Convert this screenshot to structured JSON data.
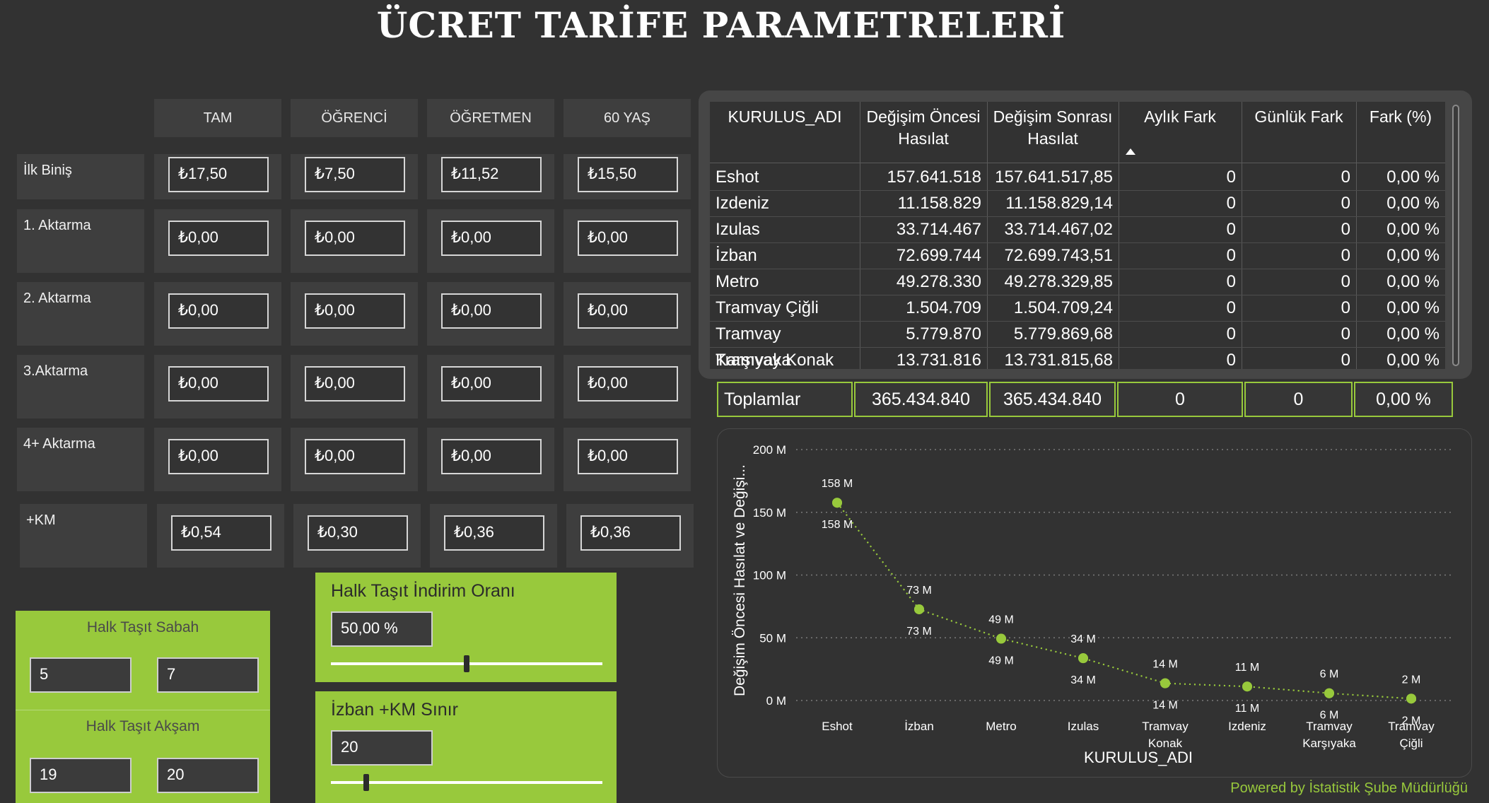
{
  "title": "ÜCRET TARİFE PARAMETRELERİ",
  "fare_table": {
    "columns": [
      "TAM",
      "ÖĞRENCİ",
      "ÖĞRETMEN",
      "60 YAŞ"
    ],
    "rows": [
      {
        "label": "İlk Biniş",
        "values": [
          "₺17,50",
          "₺7,50",
          "₺11,52",
          "₺15,50"
        ]
      },
      {
        "label": "1. Aktarma",
        "values": [
          "₺0,00",
          "₺0,00",
          "₺0,00",
          "₺0,00"
        ]
      },
      {
        "label": "2. Aktarma",
        "values": [
          "₺0,00",
          "₺0,00",
          "₺0,00",
          "₺0,00"
        ]
      },
      {
        "label": "3.Aktarma",
        "values": [
          "₺0,00",
          "₺0,00",
          "₺0,00",
          "₺0,00"
        ]
      },
      {
        "label": "4+ Aktarma",
        "values": [
          "₺0,00",
          "₺0,00",
          "₺0,00",
          "₺0,00"
        ]
      },
      {
        "label": "+KM",
        "values": [
          "₺0,54",
          "₺0,30",
          "₺0,36",
          "₺0,36"
        ]
      }
    ]
  },
  "hours": {
    "morning_label": "Halk Taşıt Sabah",
    "morning_values": [
      "5",
      "7"
    ],
    "evening_label": "Halk Taşıt Akşam",
    "evening_values": [
      "19",
      "20"
    ]
  },
  "discount": {
    "label": "Halk Taşıt İndirim Oranı",
    "value": "50,00 %",
    "slider_fraction": 0.5
  },
  "izban_km": {
    "label": "İzban +KM Sınır",
    "value": "20",
    "slider_fraction": 0.13
  },
  "revenue_table": {
    "headers": [
      "KURULUS_ADI",
      "Değişim Öncesi Hasılat",
      "Değişim Sonrası Hasılat",
      "Aylık Fark",
      "Günlük Fark",
      "Fark (%)"
    ],
    "rows": [
      [
        "Eshot",
        "157.641.518",
        "157.641.517,85",
        "0",
        "0",
        "0,00 %"
      ],
      [
        "Izdeniz",
        "11.158.829",
        "11.158.829,14",
        "0",
        "0",
        "0,00 %"
      ],
      [
        "Izulas",
        "33.714.467",
        "33.714.467,02",
        "0",
        "0",
        "0,00 %"
      ],
      [
        "İzban",
        "72.699.744",
        "72.699.743,51",
        "0",
        "0",
        "0,00 %"
      ],
      [
        "Metro",
        "49.278.330",
        "49.278.329,85",
        "0",
        "0",
        "0,00 %"
      ],
      [
        "Tramvay Çiğli",
        "1.504.709",
        "1.504.709,24",
        "0",
        "0",
        "0,00 %"
      ],
      [
        "Tramvay Karşıyaka",
        "5.779.870",
        "5.779.869,68",
        "0",
        "0",
        "0,00 %"
      ],
      [
        "Tramvay Konak",
        "13.731.816",
        "13.731.815,68",
        "0",
        "0",
        "0,00 %"
      ]
    ],
    "totals_label": "Toplamlar",
    "totals": [
      "365.434.840",
      "365.434.840",
      "0",
      "0",
      "0,00 %"
    ]
  },
  "chart_data": {
    "type": "line",
    "categories": [
      "Eshot",
      "İzban",
      "Metro",
      "Izulas",
      "Tramvay Konak",
      "Izdeniz",
      "Tramvay Karşıyaka",
      "Tramvay Çiğli"
    ],
    "category_lines": [
      [
        "Eshot"
      ],
      [
        "İzban"
      ],
      [
        "Metro"
      ],
      [
        "Izulas"
      ],
      [
        "Tramvay",
        "Konak"
      ],
      [
        "Izdeniz"
      ],
      [
        "Tramvay",
        "Karşıyaka"
      ],
      [
        "Tramvay",
        "Çiğli"
      ]
    ],
    "series": [
      {
        "values": [
          157.64,
          72.7,
          49.28,
          33.71,
          13.73,
          11.16,
          5.78,
          1.5
        ],
        "labels": [
          "158 M",
          "73 M",
          "49 M",
          "34 M",
          "14 M",
          "11 M",
          "6 M",
          "2 M"
        ]
      },
      {
        "values": [
          157.64,
          72.7,
          49.28,
          33.71,
          13.73,
          11.16,
          5.78,
          1.5
        ],
        "labels": [
          "158 M",
          "73 M",
          "49 M",
          "34 M",
          "14 M",
          "11 M",
          "6 M",
          "2 M"
        ]
      }
    ],
    "xlabel": "KURULUS_ADI",
    "ylabel": "Değişim Öncesi Hasılat ve Değişi...",
    "yticks": [
      "0 M",
      "50 M",
      "100 M",
      "150 M",
      "200 M"
    ],
    "ylim": [
      0,
      200
    ],
    "grid": true,
    "color": "#98c93c"
  },
  "footer": "Powered by İstatistik Şube Müdürlüğü"
}
